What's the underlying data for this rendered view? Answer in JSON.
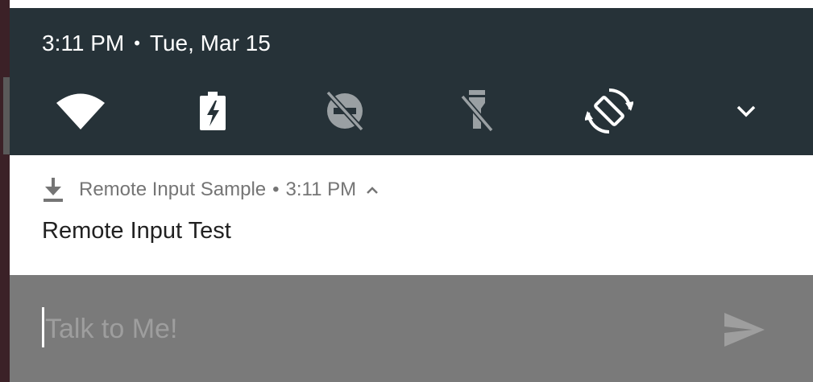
{
  "status_bar": {
    "time": "3:11 PM",
    "separator": "•",
    "date": "Tue, Mar 15"
  },
  "quick_settings": [
    {
      "name": "wifi",
      "icon": "wifi-icon"
    },
    {
      "name": "battery-charging",
      "icon": "battery-charging-icon"
    },
    {
      "name": "do-not-disturb-off",
      "icon": "dnd-off-icon"
    },
    {
      "name": "flashlight-off",
      "icon": "flashlight-off-icon"
    },
    {
      "name": "auto-rotate",
      "icon": "auto-rotate-icon"
    },
    {
      "name": "expand",
      "icon": "chevron-down-icon"
    }
  ],
  "notification": {
    "icon": "download-icon",
    "app_name": "Remote Input Sample",
    "separator": "•",
    "time": "3:11 PM",
    "title": "Remote Input Test",
    "reply": {
      "placeholder": "Talk to Me!",
      "value": "",
      "send_icon": "send-icon"
    }
  },
  "colors": {
    "shade_bg": "#263238",
    "card_bg": "#ffffff",
    "reply_bg": "#7a7a7a",
    "header_text": "#757575",
    "title_text": "#212121"
  }
}
